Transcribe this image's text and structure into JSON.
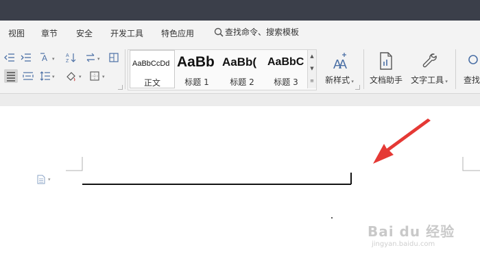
{
  "menubar": {
    "items": [
      "视图",
      "章节",
      "安全",
      "开发工具",
      "特色应用"
    ],
    "search_label": "查找命令、搜索模板"
  },
  "ribbon": {
    "styles": [
      {
        "preview": "AaBbCcDd",
        "label": "正文"
      },
      {
        "preview": "AaBb",
        "label": "标题 1"
      },
      {
        "preview": "AaBb(",
        "label": "标题 2"
      },
      {
        "preview": "AaBbC",
        "label": "标题 3"
      }
    ],
    "new_style": "新样式",
    "doc_assistant": "文档助手",
    "text_tools": "文字工具",
    "find": "查找"
  },
  "colors": {
    "titlebar": "#3b3f4a",
    "ribbon_bg": "#f3f3f3",
    "arrow": "#e53935"
  },
  "watermark": {
    "main": "Bai du 经验",
    "sub": "jingyan.baidu.com"
  }
}
